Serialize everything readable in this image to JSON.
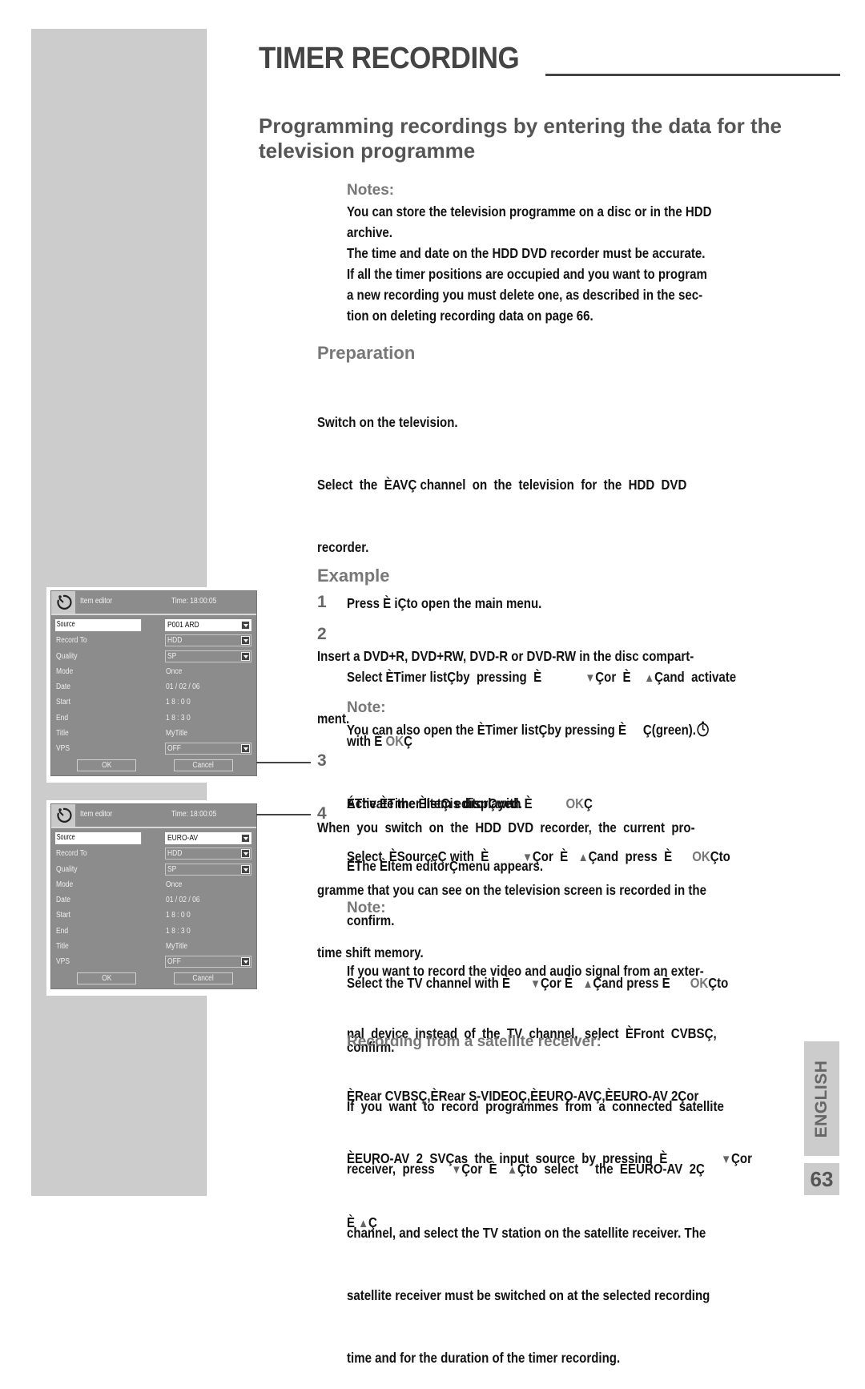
{
  "header": {
    "title": "TIMER RECORDING",
    "subtitle": "Programming recordings by entering the data for the television programme"
  },
  "notes": {
    "heading": "Notes:",
    "lines": [
      "You can store the television programme on a disc or in the HDD",
      "archive.",
      "The time and date on the HDD DVD recorder must be accurate.",
      "If all the timer positions are occupied and you want to program",
      "a new recording you must delete one, as described in the sec-",
      "tion on deleting recording data on page 66."
    ]
  },
  "preparation": {
    "heading": "Preparation",
    "p1": "Switch on the television.",
    "p2a": "Select  the  ÈAVÇ channel  on  the  television  for  the  HDD  DVD",
    "p2b": "recorder.",
    "p3a": "Insert a DVD+R, DVD+RW, DVD-R or DVD-RW in the disc compart-",
    "p3b": "ment.",
    "p4a": "When  you  switch  on  the  HDD  DVD  recorder,  the  current  pro-",
    "p4b": "gramme that you can see on the television screen is recorded in the",
    "p4c": "time shift memory."
  },
  "example": {
    "heading": "Example",
    "steps": [
      {
        "num": "1",
        "lines": [
          "Press È iÇto open the main menu."
        ]
      },
      {
        "num": "2",
        "line1_a": "Select ÈTimer listÇby  pressing  È",
        "line1_b": "Çor  È",
        "line1_c": "Çand  activate",
        "line2_a": "with È ",
        "line2_ok": "OK",
        "line2_b": "Ç",
        "line3": "ÉThe ÈTimer listÇis displayed."
      },
      {
        "num": "3",
        "line1_a": "Activate the ÈItem editorÇwith È",
        "line1_ok": "OK",
        "line1_b": "Ç",
        "line2": "ÉThe ÈItem editorÇmenu appears."
      },
      {
        "num": "4",
        "line1_a": "Select  ÈSourceÇ with  È",
        "line1_b": "Çor  È",
        "line1_c": "Çand  press  È",
        "line1_ok": "OK",
        "line1_d": "Çto",
        "line2": "confirm.",
        "line3_a": "Select the TV channel with È",
        "line3_b": "Çor È",
        "line3_c": "Çand press È",
        "line3_ok": "OK",
        "line3_d": "Çto",
        "line4": "confirm."
      }
    ],
    "note1": {
      "heading": "Note:",
      "text_a": "You can also open the ÈTimer listÇby pressing È",
      "text_b": "Ç(green).",
      "icon": "timer-clock-icon"
    },
    "note2": {
      "heading": "Note:",
      "lines": [
        "If you want to record the video and audio signal from an exter-",
        "nal  device  instead  of  the  TV  channel,  select  ÈFront  CVBSÇ,",
        "ÈRear CVBSÇ,ÈRear S-VIDEOÇ,ÈEURO-AVÇ,ÈEURO-AV 2Çor"
      ],
      "line4_a": "ÈEURO-AV  2  SVÇas  the  input  source  by  pressing  È",
      "line4_b": "Çor",
      "line5_a": "È",
      "line5_b": "Ç"
    }
  },
  "satellite": {
    "heading": "Recording from a satellite receiver:",
    "line1": "If  you  want  to  record  programmes  from  a  connected  satellite",
    "line2_a": "receiver,  press",
    "line2_b": "Çor  È",
    "line2_c": "Çto  select     the  ÈEURO-AV  2Ç",
    "line3": "channel, and select the TV station on the satellite receiver. The",
    "line4": "satellite receiver must be switched on at the selected recording",
    "line5": "time and for the duration of the timer recording."
  },
  "arrows": {
    "down": "▼",
    "up": "▲"
  },
  "screens": [
    {
      "title": "Item editor",
      "time": "Time: 18:00:05",
      "rows": [
        {
          "label": "Source",
          "value": "P001 ARD",
          "type": "dropdown",
          "selected": true
        },
        {
          "label": "Record To",
          "value": "HDD",
          "type": "dropdown"
        },
        {
          "label": "Quality",
          "value": "SP",
          "type": "dropdown"
        },
        {
          "label": "Mode",
          "value": "Once",
          "type": "text"
        },
        {
          "label": "Date",
          "value": "01 / 02 / 06",
          "type": "text"
        },
        {
          "label": "Start",
          "value": "1 8 : 0 0",
          "type": "text"
        },
        {
          "label": "End",
          "value": "1 8 : 3 0",
          "type": "text"
        },
        {
          "label": "Title",
          "value": "MyTitle",
          "type": "text"
        },
        {
          "label": "VPS",
          "value": "OFF",
          "type": "dropdown"
        }
      ],
      "ok": "OK",
      "cancel": "Cancel",
      "callout": "3"
    },
    {
      "title": "Item editor",
      "time": "Time: 18:00:05",
      "rows": [
        {
          "label": "Source",
          "value": "EURO-AV",
          "type": "dropdown",
          "selected": true
        },
        {
          "label": "Record To",
          "value": "HDD",
          "type": "dropdown"
        },
        {
          "label": "Quality",
          "value": "SP",
          "type": "dropdown"
        },
        {
          "label": "Mode",
          "value": "Once",
          "type": "text"
        },
        {
          "label": "Date",
          "value": "01 / 02 / 06",
          "type": "text"
        },
        {
          "label": "Start",
          "value": "1 8 : 0 0",
          "type": "text"
        },
        {
          "label": "End",
          "value": "1 8 : 3 0",
          "type": "text"
        },
        {
          "label": "Title",
          "value": "MyTitle",
          "type": "text"
        },
        {
          "label": "VPS",
          "value": "OFF",
          "type": "dropdown"
        }
      ],
      "ok": "OK",
      "cancel": "Cancel",
      "callout": "4"
    }
  ],
  "footer": {
    "language": "ENGLISH",
    "page_number": "63"
  },
  "colors": {
    "sidebar": "#cccccc",
    "panel": "#8c8c8c",
    "heading_gray": "#777777",
    "title_gray": "#444444"
  }
}
